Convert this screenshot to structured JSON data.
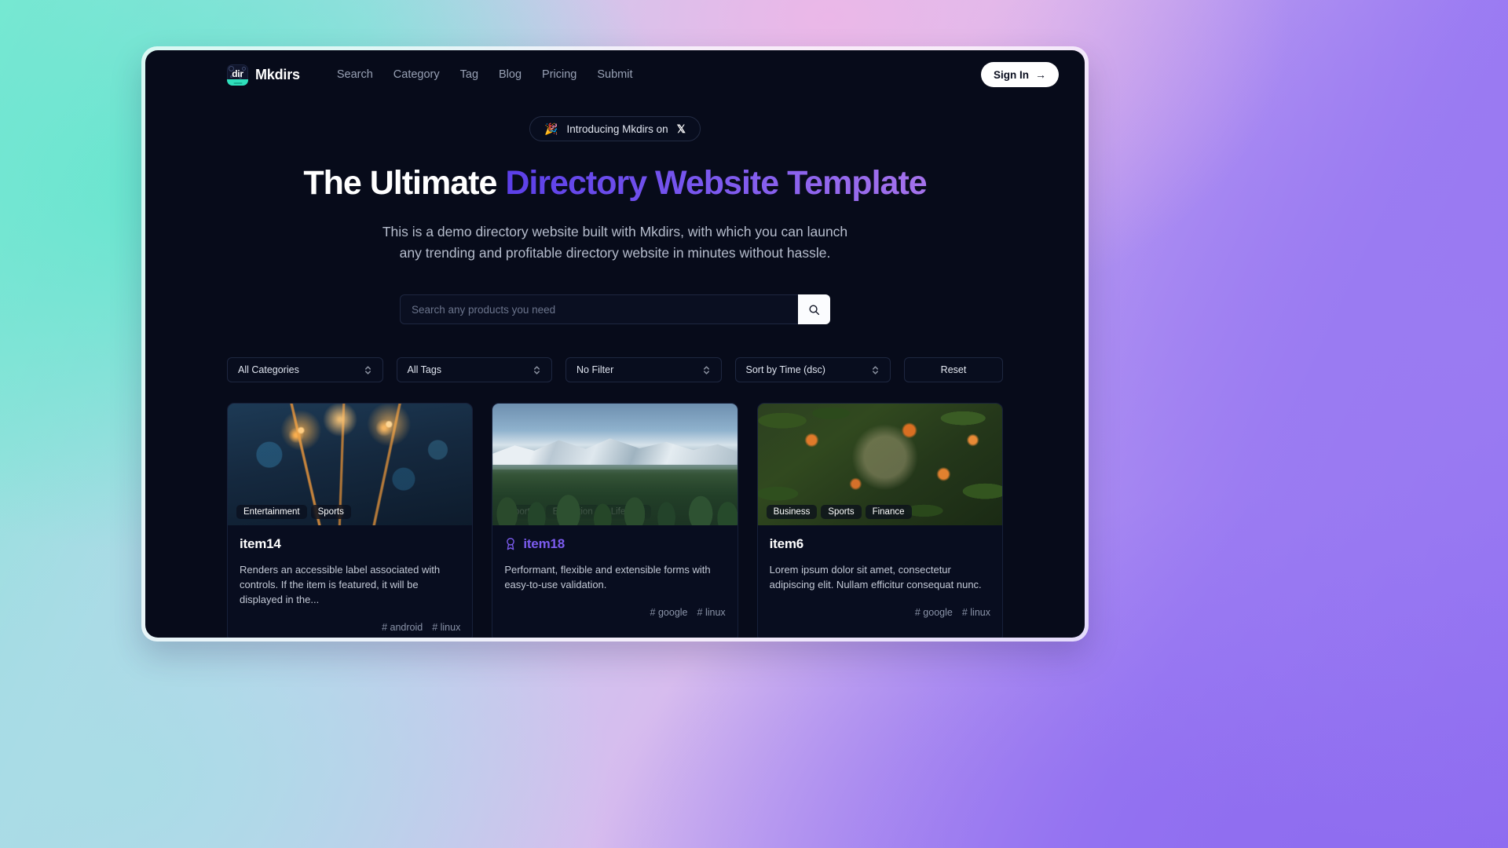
{
  "header": {
    "logo_text": "dir",
    "brand": "Mkdirs",
    "nav": [
      {
        "label": "Search"
      },
      {
        "label": "Category"
      },
      {
        "label": "Tag"
      },
      {
        "label": "Blog"
      },
      {
        "label": "Pricing"
      },
      {
        "label": "Submit"
      }
    ],
    "signin_label": "Sign In",
    "signin_arrow": "→"
  },
  "hero": {
    "badge_emoji": "🎉",
    "badge_text": "Introducing Mkdirs on",
    "badge_x": "𝕏",
    "title_plain": "The Ultimate ",
    "title_gradient": "Directory Website Template",
    "subtitle_line1": "This is a demo directory website built with Mkdirs, with which you can launch",
    "subtitle_line2": "any trending and profitable directory website in minutes without hassle."
  },
  "search": {
    "placeholder": "Search any products you need",
    "value": "",
    "button_icon": "search-icon"
  },
  "filters": {
    "category": "All Categories",
    "tag": "All Tags",
    "filter": "No Filter",
    "sort": "Sort by Time (dsc)",
    "reset_label": "Reset"
  },
  "cards": [
    {
      "categories": [
        "Entertainment",
        "Sports"
      ],
      "title": "item14",
      "featured": false,
      "description": "Renders an accessible label associated with controls. If the item is featured, it will be displayed in the...",
      "tags": [
        "# android",
        "# linux"
      ]
    },
    {
      "categories": [
        "Sports",
        "Education",
        "Lifestyle"
      ],
      "title": "item18",
      "featured": true,
      "description": "Performant, flexible and extensible forms with easy-to-use validation.",
      "tags": [
        "# google",
        "# linux"
      ]
    },
    {
      "categories": [
        "Business",
        "Sports",
        "Finance"
      ],
      "title": "item6",
      "featured": false,
      "description": "Lorem ipsum dolor sit amet, consectetur adipiscing elit. Nullam efficitur consequat nunc.",
      "tags": [
        "# google",
        "# linux"
      ]
    }
  ],
  "colors": {
    "panel_bg": "#070B1A",
    "accent_purple": "#7C5CF0",
    "gradient_start": "#5B3FE8",
    "gradient_end": "#A573EC",
    "logo_teal": "#2FE0BC"
  }
}
